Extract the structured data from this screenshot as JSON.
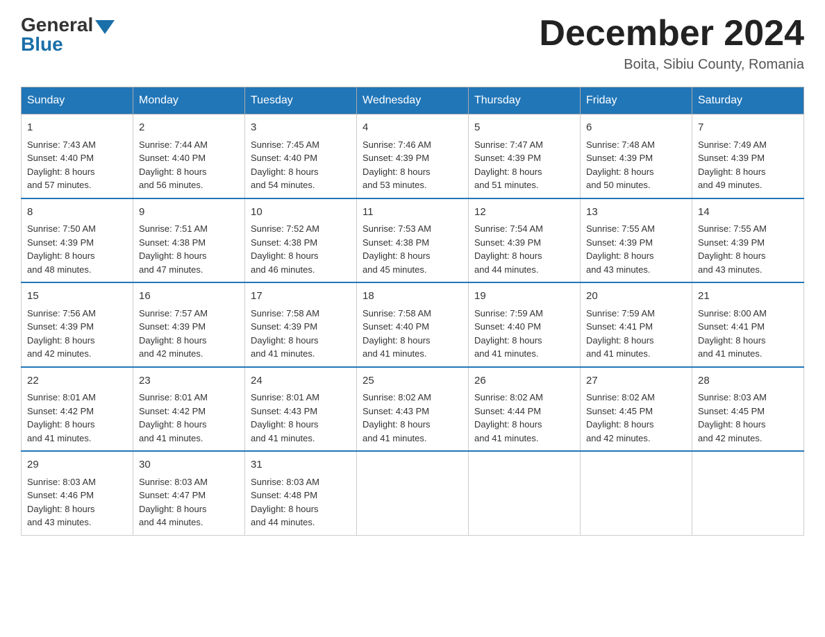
{
  "header": {
    "logo_general": "General",
    "logo_blue": "Blue",
    "month_title": "December 2024",
    "location": "Boita, Sibiu County, Romania"
  },
  "days_of_week": [
    "Sunday",
    "Monday",
    "Tuesday",
    "Wednesday",
    "Thursday",
    "Friday",
    "Saturday"
  ],
  "weeks": [
    [
      {
        "day": "1",
        "sunrise": "7:43 AM",
        "sunset": "4:40 PM",
        "daylight": "8 hours and 57 minutes."
      },
      {
        "day": "2",
        "sunrise": "7:44 AM",
        "sunset": "4:40 PM",
        "daylight": "8 hours and 56 minutes."
      },
      {
        "day": "3",
        "sunrise": "7:45 AM",
        "sunset": "4:40 PM",
        "daylight": "8 hours and 54 minutes."
      },
      {
        "day": "4",
        "sunrise": "7:46 AM",
        "sunset": "4:39 PM",
        "daylight": "8 hours and 53 minutes."
      },
      {
        "day": "5",
        "sunrise": "7:47 AM",
        "sunset": "4:39 PM",
        "daylight": "8 hours and 51 minutes."
      },
      {
        "day": "6",
        "sunrise": "7:48 AM",
        "sunset": "4:39 PM",
        "daylight": "8 hours and 50 minutes."
      },
      {
        "day": "7",
        "sunrise": "7:49 AM",
        "sunset": "4:39 PM",
        "daylight": "8 hours and 49 minutes."
      }
    ],
    [
      {
        "day": "8",
        "sunrise": "7:50 AM",
        "sunset": "4:39 PM",
        "daylight": "8 hours and 48 minutes."
      },
      {
        "day": "9",
        "sunrise": "7:51 AM",
        "sunset": "4:38 PM",
        "daylight": "8 hours and 47 minutes."
      },
      {
        "day": "10",
        "sunrise": "7:52 AM",
        "sunset": "4:38 PM",
        "daylight": "8 hours and 46 minutes."
      },
      {
        "day": "11",
        "sunrise": "7:53 AM",
        "sunset": "4:38 PM",
        "daylight": "8 hours and 45 minutes."
      },
      {
        "day": "12",
        "sunrise": "7:54 AM",
        "sunset": "4:39 PM",
        "daylight": "8 hours and 44 minutes."
      },
      {
        "day": "13",
        "sunrise": "7:55 AM",
        "sunset": "4:39 PM",
        "daylight": "8 hours and 43 minutes."
      },
      {
        "day": "14",
        "sunrise": "7:55 AM",
        "sunset": "4:39 PM",
        "daylight": "8 hours and 43 minutes."
      }
    ],
    [
      {
        "day": "15",
        "sunrise": "7:56 AM",
        "sunset": "4:39 PM",
        "daylight": "8 hours and 42 minutes."
      },
      {
        "day": "16",
        "sunrise": "7:57 AM",
        "sunset": "4:39 PM",
        "daylight": "8 hours and 42 minutes."
      },
      {
        "day": "17",
        "sunrise": "7:58 AM",
        "sunset": "4:39 PM",
        "daylight": "8 hours and 41 minutes."
      },
      {
        "day": "18",
        "sunrise": "7:58 AM",
        "sunset": "4:40 PM",
        "daylight": "8 hours and 41 minutes."
      },
      {
        "day": "19",
        "sunrise": "7:59 AM",
        "sunset": "4:40 PM",
        "daylight": "8 hours and 41 minutes."
      },
      {
        "day": "20",
        "sunrise": "7:59 AM",
        "sunset": "4:41 PM",
        "daylight": "8 hours and 41 minutes."
      },
      {
        "day": "21",
        "sunrise": "8:00 AM",
        "sunset": "4:41 PM",
        "daylight": "8 hours and 41 minutes."
      }
    ],
    [
      {
        "day": "22",
        "sunrise": "8:01 AM",
        "sunset": "4:42 PM",
        "daylight": "8 hours and 41 minutes."
      },
      {
        "day": "23",
        "sunrise": "8:01 AM",
        "sunset": "4:42 PM",
        "daylight": "8 hours and 41 minutes."
      },
      {
        "day": "24",
        "sunrise": "8:01 AM",
        "sunset": "4:43 PM",
        "daylight": "8 hours and 41 minutes."
      },
      {
        "day": "25",
        "sunrise": "8:02 AM",
        "sunset": "4:43 PM",
        "daylight": "8 hours and 41 minutes."
      },
      {
        "day": "26",
        "sunrise": "8:02 AM",
        "sunset": "4:44 PM",
        "daylight": "8 hours and 41 minutes."
      },
      {
        "day": "27",
        "sunrise": "8:02 AM",
        "sunset": "4:45 PM",
        "daylight": "8 hours and 42 minutes."
      },
      {
        "day": "28",
        "sunrise": "8:03 AM",
        "sunset": "4:45 PM",
        "daylight": "8 hours and 42 minutes."
      }
    ],
    [
      {
        "day": "29",
        "sunrise": "8:03 AM",
        "sunset": "4:46 PM",
        "daylight": "8 hours and 43 minutes."
      },
      {
        "day": "30",
        "sunrise": "8:03 AM",
        "sunset": "4:47 PM",
        "daylight": "8 hours and 44 minutes."
      },
      {
        "day": "31",
        "sunrise": "8:03 AM",
        "sunset": "4:48 PM",
        "daylight": "8 hours and 44 minutes."
      },
      null,
      null,
      null,
      null
    ]
  ],
  "labels": {
    "sunrise": "Sunrise:",
    "sunset": "Sunset:",
    "daylight": "Daylight:"
  }
}
